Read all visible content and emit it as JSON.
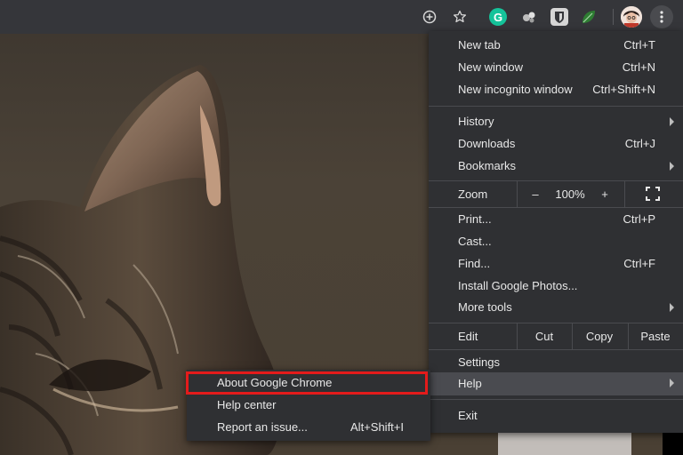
{
  "toolbar": {
    "icons": [
      "add-circle-icon",
      "star-icon",
      "grammarly-icon",
      "extension-icon",
      "bitwarden-icon",
      "leaf-icon",
      "avatar",
      "more-vert-icon"
    ],
    "grammarly_letter": "G",
    "colors": {
      "toolbar_bg": "#35363a",
      "grammarly": "#15c39a",
      "bitwarden": "#d0d0d0"
    }
  },
  "menu": {
    "group1": [
      {
        "label": "New tab",
        "shortcut": "Ctrl+T"
      },
      {
        "label": "New window",
        "shortcut": "Ctrl+N"
      },
      {
        "label": "New incognito window",
        "shortcut": "Ctrl+Shift+N"
      }
    ],
    "group2": [
      {
        "label": "History",
        "submenu": true
      },
      {
        "label": "Downloads",
        "shortcut": "Ctrl+J"
      },
      {
        "label": "Bookmarks",
        "submenu": true
      }
    ],
    "zoom": {
      "label": "Zoom",
      "minus": "–",
      "value": "100%",
      "plus": "+",
      "fullscreen_icon": "fullscreen-icon"
    },
    "group3": [
      {
        "label": "Print...",
        "shortcut": "Ctrl+P"
      },
      {
        "label": "Cast..."
      },
      {
        "label": "Find...",
        "shortcut": "Ctrl+F"
      },
      {
        "label": "Install Google Photos..."
      },
      {
        "label": "More tools",
        "submenu": true
      }
    ],
    "edit": {
      "label": "Edit",
      "cut": "Cut",
      "copy": "Copy",
      "paste": "Paste"
    },
    "group4": [
      {
        "label": "Settings"
      },
      {
        "label": "Help",
        "submenu": true,
        "active": true
      }
    ],
    "exit": {
      "label": "Exit"
    }
  },
  "help_submenu": {
    "items": [
      {
        "label": "About Google Chrome",
        "highlighted": true
      },
      {
        "label": "Help center"
      },
      {
        "label": "Report an issue...",
        "shortcut": "Alt+Shift+I"
      }
    ],
    "highlight_color": "#e41b1b"
  }
}
